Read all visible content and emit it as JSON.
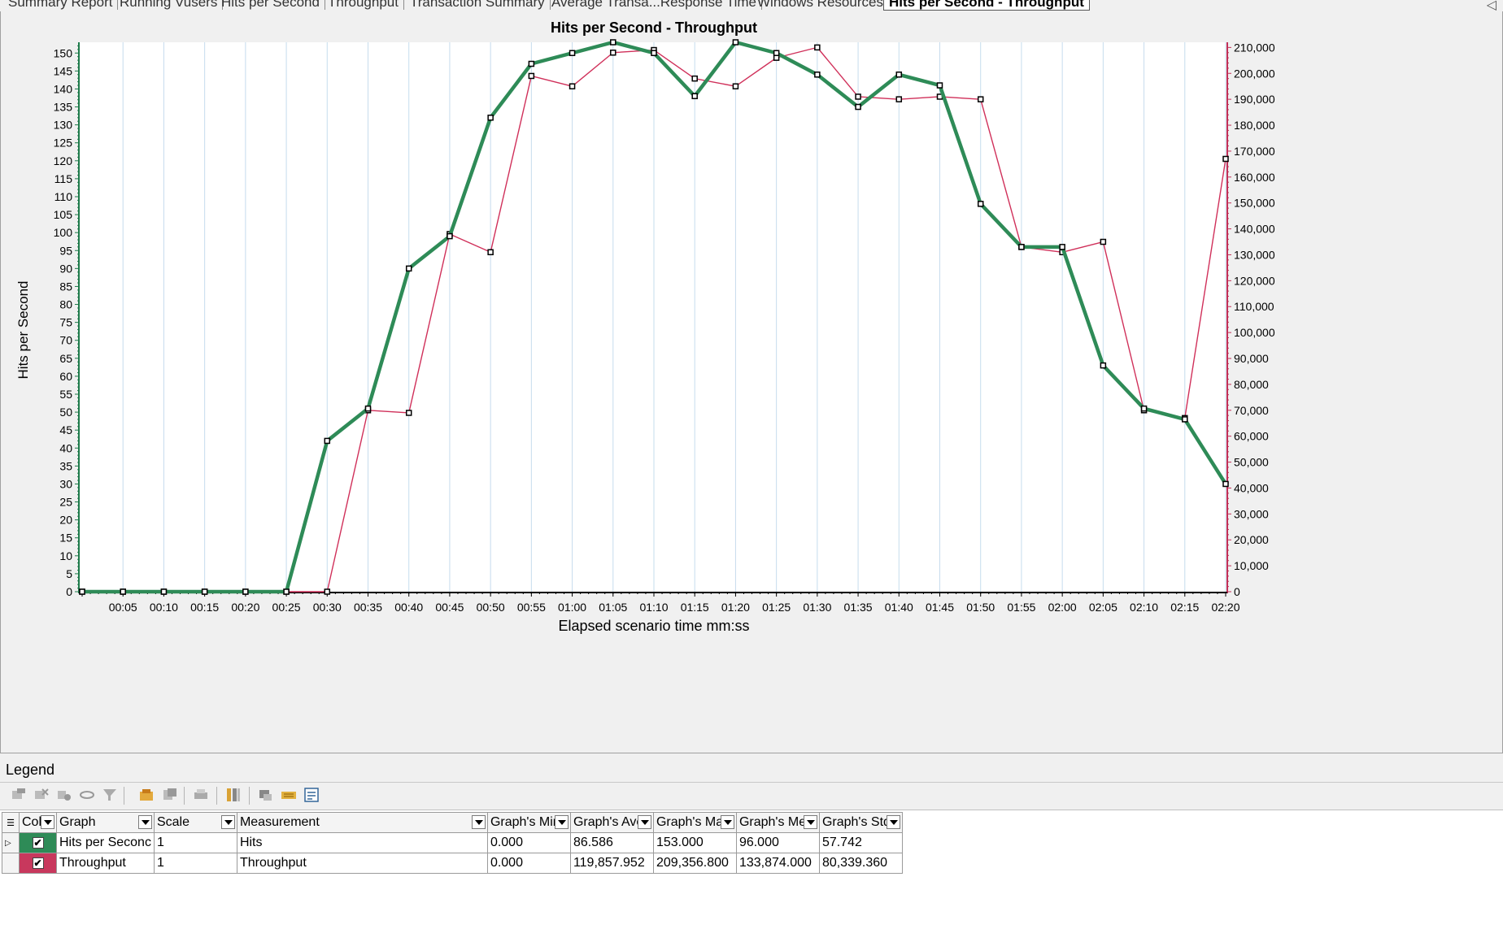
{
  "tabs": [
    {
      "label": "Summary Report",
      "active": false
    },
    {
      "label": "Running Vusers",
      "active": false
    },
    {
      "label": "Hits per Second",
      "active": false
    },
    {
      "label": "Throughput",
      "active": false
    },
    {
      "label": "Transaction Summary",
      "active": false
    },
    {
      "label": "Average Transa...Response Time",
      "active": false
    },
    {
      "label": "Windows Resources",
      "active": false
    },
    {
      "label": "Hits per Second - Throughput",
      "active": true
    }
  ],
  "chart_data": {
    "type": "line",
    "title": "Hits per Second - Throughput",
    "xlabel": "Elapsed scenario time mm:ss",
    "ylabel": "Hits per Second",
    "ylabel_right": "",
    "x": [
      "00:00",
      "00:05",
      "00:10",
      "00:15",
      "00:20",
      "00:25",
      "00:30",
      "00:35",
      "00:40",
      "00:45",
      "00:50",
      "00:55",
      "01:00",
      "01:05",
      "01:10",
      "01:15",
      "01:20",
      "01:25",
      "01:30",
      "01:35",
      "01:40",
      "01:45",
      "01:50",
      "01:55",
      "02:00",
      "02:05",
      "02:10",
      "02:15",
      "02:20"
    ],
    "x_tick_labels": [
      "00:05",
      "00:10",
      "00:15",
      "00:20",
      "00:25",
      "00:30",
      "00:35",
      "00:40",
      "00:45",
      "00:50",
      "00:55",
      "01:00",
      "01:05",
      "01:10",
      "01:15",
      "01:20",
      "01:25",
      "01:30",
      "01:35",
      "01:40",
      "01:45",
      "01:50",
      "01:55",
      "02:00",
      "02:05",
      "02:10",
      "02:15",
      "02:20"
    ],
    "ylim_left": [
      0,
      153
    ],
    "yticks_left": [
      0,
      5,
      10,
      15,
      20,
      25,
      30,
      35,
      40,
      45,
      50,
      55,
      60,
      65,
      70,
      75,
      80,
      85,
      90,
      95,
      100,
      105,
      110,
      115,
      120,
      125,
      130,
      135,
      140,
      145,
      150
    ],
    "ylim_right": [
      0,
      212000
    ],
    "yticks_right": [
      0,
      10000,
      20000,
      30000,
      40000,
      50000,
      60000,
      70000,
      80000,
      90000,
      100000,
      110000,
      120000,
      130000,
      140000,
      150000,
      160000,
      170000,
      180000,
      190000,
      200000,
      210000
    ],
    "ytick_labels_right": [
      "0",
      "10,000",
      "20,000",
      "30,000",
      "40,000",
      "50,000",
      "60,000",
      "70,000",
      "80,000",
      "90,000",
      "100,000",
      "110,000",
      "120,000",
      "130,000",
      "140,000",
      "150,000",
      "160,000",
      "170,000",
      "180,000",
      "190,000",
      "200,000",
      "210,000"
    ],
    "grid": "vertical",
    "series": [
      {
        "name": "Hits per Second",
        "axis": "left",
        "color": "#2e8b57",
        "values": [
          0,
          0,
          0,
          0,
          0,
          0,
          42,
          51,
          90,
          99,
          132,
          147,
          150,
          153,
          150,
          138,
          153,
          150,
          144,
          135,
          144,
          141,
          108,
          96,
          96,
          63,
          51,
          48,
          30
        ]
      },
      {
        "name": "Throughput",
        "axis": "right",
        "color": "#d0305a",
        "values": [
          0,
          0,
          0,
          0,
          0,
          0,
          0,
          70000,
          69000,
          138000,
          131000,
          199000,
          195000,
          208000,
          209000,
          198000,
          195000,
          206000,
          210000,
          191000,
          190000,
          191000,
          190000,
          133000,
          131000,
          135000,
          70000,
          67000,
          167000
        ]
      }
    ]
  },
  "legend": {
    "title": "Legend",
    "columns": [
      "Col",
      "Graph",
      "Scale",
      "Measurement",
      "Graph's Mini",
      "Graph's Ave",
      "Graph's Max",
      "Graph's Med",
      "Graph's Std."
    ],
    "rows": [
      {
        "color": "#2e8b57",
        "checked": true,
        "graph": "Hits per Seconc",
        "scale": "1",
        "measurement": "Hits",
        "min": "0.000",
        "avg": "86.586",
        "max": "153.000",
        "med": "96.000",
        "std": "57.742",
        "selected": true
      },
      {
        "color": "#c8385d",
        "checked": true,
        "graph": "Throughput",
        "scale": "1",
        "measurement": "Throughput",
        "min": "0.000",
        "avg": "119,857.952",
        "max": "209,356.800",
        "med": "133,874.000",
        "std": "80,339.360",
        "selected": false
      }
    ]
  },
  "toolbar_icons": [
    "show-graph-icon",
    "hide-graph-icon",
    "configure-measurement-icon",
    "show-all-icon",
    "filter-icon",
    "export-icon",
    "copy-icon",
    "print-icon",
    "columns-icon",
    "animate-icon",
    "highlight-icon",
    "properties-icon"
  ]
}
